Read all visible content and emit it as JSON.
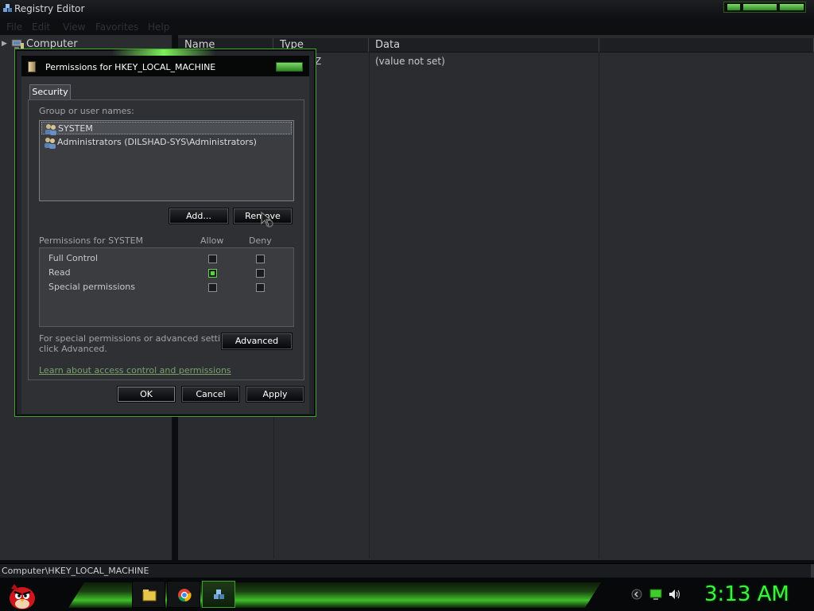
{
  "window": {
    "title": "Registry Editor",
    "menu": [
      "File",
      "Edit",
      "View",
      "Favorites",
      "Help"
    ]
  },
  "tree": {
    "root_label": "Computer"
  },
  "list": {
    "columns": [
      "Name",
      "Type",
      "Data"
    ],
    "rows": [
      {
        "name": "",
        "type": "Z",
        "data": "(value not set)"
      }
    ]
  },
  "statusbar": {
    "path": "Computer\\HKEY_LOCAL_MACHINE"
  },
  "dialog": {
    "title": "Permissions for HKEY_LOCAL_MACHINE",
    "tab": "Security",
    "group_label": "Group or user names:",
    "users": [
      {
        "label": "SYSTEM",
        "selected": true
      },
      {
        "label": "Administrators (DILSHAD-SYS\\Administrators)",
        "selected": false
      }
    ],
    "add_label": "Add...",
    "remove_label": "Remove",
    "permissions_label": "Permissions for SYSTEM",
    "allow_label": "Allow",
    "deny_label": "Deny",
    "permissions": [
      {
        "name": "Full Control",
        "allow": false,
        "deny": false
      },
      {
        "name": "Read",
        "allow": true,
        "deny": false
      },
      {
        "name": "Special permissions",
        "allow": false,
        "deny": false
      }
    ],
    "advanced_text_line1": "For special permissions or advanced settings,",
    "advanced_text_line2": "click Advanced.",
    "advanced_label": "Advanced",
    "learn_link": "Learn about access control and permissions",
    "ok_label": "OK",
    "cancel_label": "Cancel",
    "apply_label": "Apply"
  },
  "taskbar": {
    "clock": "3:13 AM",
    "apps": [
      "file-explorer-icon",
      "chrome-icon",
      "registry-editor-icon"
    ],
    "accent": "#3cf23f"
  }
}
